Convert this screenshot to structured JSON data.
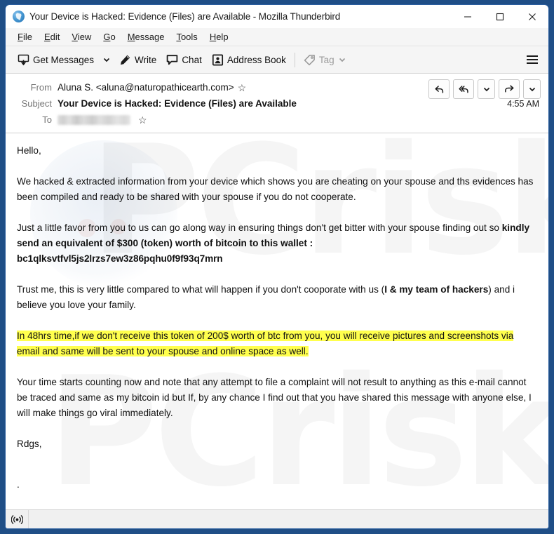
{
  "window": {
    "title": "Your Device is Hacked: Evidence (Files) are Available - Mozilla Thunderbird",
    "app_icon": "thunderbird-icon",
    "controls": {
      "minimize": "minimize-icon",
      "maximize": "maximize-icon",
      "close": "close-icon"
    }
  },
  "menubar": {
    "items": [
      {
        "accesskey": "F",
        "rest": "ile"
      },
      {
        "accesskey": "E",
        "rest": "dit"
      },
      {
        "accesskey": "V",
        "rest": "iew"
      },
      {
        "accesskey": "G",
        "rest": "o"
      },
      {
        "accesskey": "M",
        "rest": "essage"
      },
      {
        "accesskey": "T",
        "rest": "ools"
      },
      {
        "accesskey": "H",
        "rest": "elp"
      }
    ]
  },
  "toolbar": {
    "get_messages": "Get Messages",
    "write": "Write",
    "chat": "Chat",
    "address_book": "Address Book",
    "tag": "Tag",
    "tag_disabled": true,
    "app_menu": "app-menu-icon"
  },
  "message_header": {
    "from_label": "From",
    "from_value": "Aluna S. <aluna@naturopathicearth.com>",
    "subject_label": "Subject",
    "subject_value": "Your Device is Hacked: Evidence (Files) are Available",
    "to_label": "To",
    "to_value": "",
    "to_redacted": true,
    "time": "4:55 AM",
    "actions": [
      "reply-icon",
      "reply-all-icon",
      "reply-menu-chevron-icon",
      "forward-icon",
      "other-actions-chevron-icon"
    ]
  },
  "body": {
    "greeting": "Hello,",
    "paragraph_1": "We hacked & extracted information from your device which shows you are cheating on your spouse and ths evidences has been compiled and ready to be shared with your spouse if you do not cooperate.",
    "paragraph_2_lead": "Just a little favor from you to us can go along way in ensuring things don't get bitter with your spouse finding out so ",
    "paragraph_2_bold": "kindly send an equivalent of $300 (token) worth of bitcoin to this wallet :",
    "wallet_address": "bc1qlksvtfvl5js2lrzs7ew3z86pqhu0f9f93q7mrn",
    "paragraph_3_a": "Trust me, this is very little compared to what will happen if you don't cooporate with us (",
    "paragraph_3_bold": "I & my team of hackers",
    "paragraph_3_b": ") and i believe you love your family.",
    "paragraph_4_highlighted": "In 48hrs time,if we don't receive this token of 200$ worth of btc from you, you will receive pictures and screenshots via email and same will be sent to your spouse and online space as well.",
    "paragraph_5": "Your time starts counting now and note that any attempt to file a complaint will not result to anything as this e-mail cannot be traced and same as my bitcoin id but If, by any chance I find out that you have shared this message with anyone else, I will make things go viral immediately.",
    "signoff": "Rdgs,",
    "trailing_dot": ".",
    "highlight_color": "#ffff4d",
    "watermark_text": "PCrisk.com"
  },
  "statusbar": {
    "connection_icon": "online-status-icon"
  }
}
